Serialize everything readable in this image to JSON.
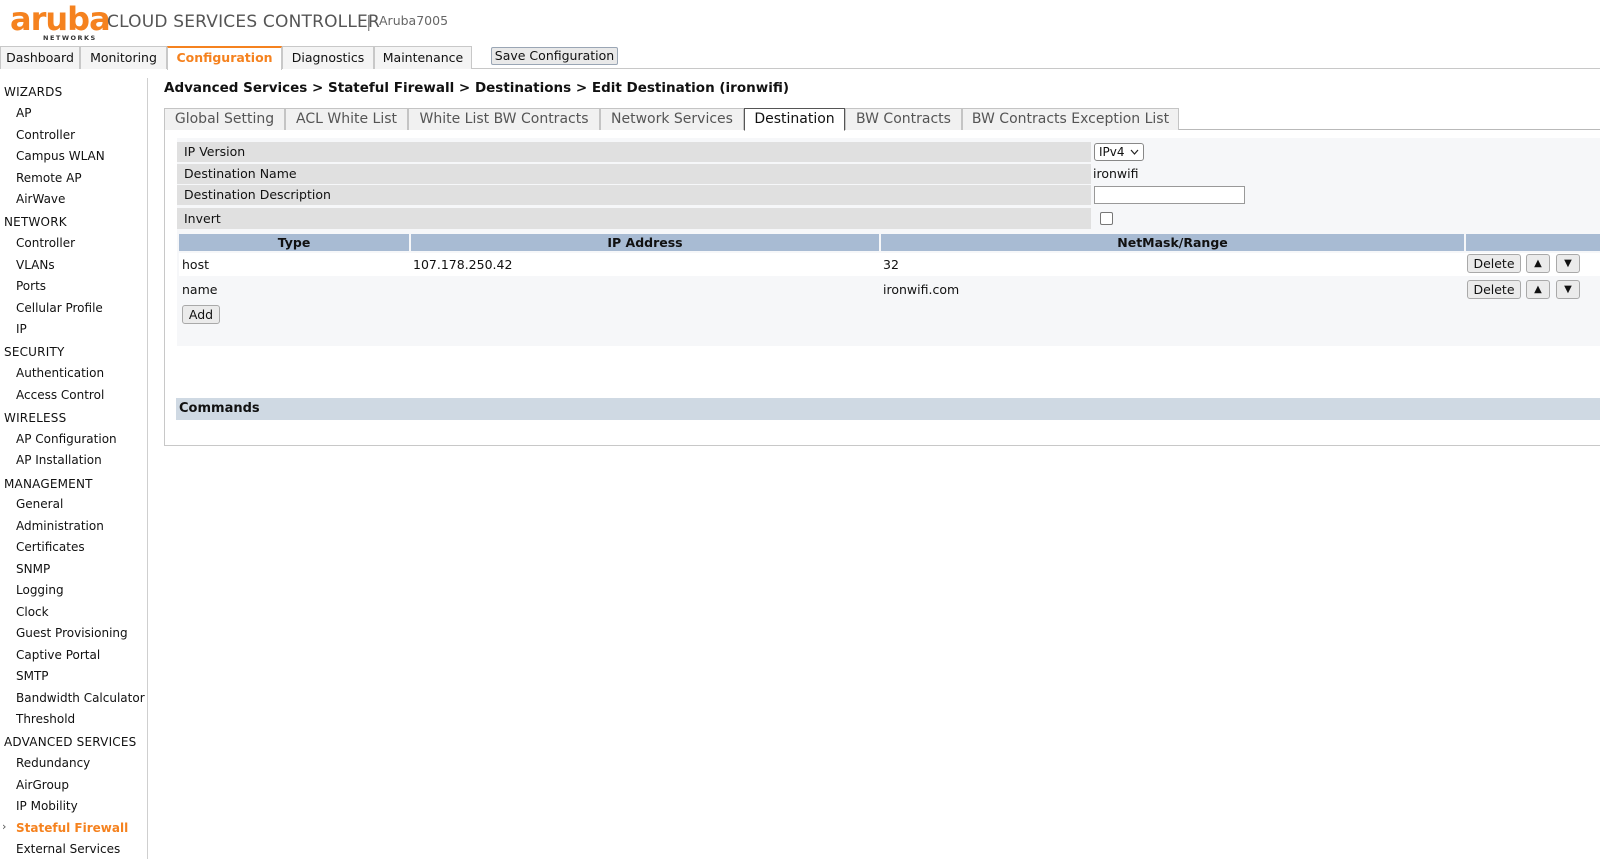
{
  "header": {
    "logo_text": "aruba",
    "logo_subtext": "NETWORKS",
    "app_title": "CLOUD SERVICES CONTROLLER",
    "separator": "|",
    "hostname": "Aruba7005",
    "accent_color": "#f5821f"
  },
  "topnav": {
    "tabs": [
      {
        "label": "Dashboard"
      },
      {
        "label": "Monitoring"
      },
      {
        "label": "Configuration",
        "active": true
      },
      {
        "label": "Diagnostics"
      },
      {
        "label": "Maintenance"
      }
    ],
    "save_label": "Save Configuration"
  },
  "sidebar": {
    "sections": [
      {
        "title": "WIZARDS",
        "items": [
          "AP",
          "Controller",
          "Campus WLAN",
          "Remote AP",
          "AirWave"
        ]
      },
      {
        "title": "NETWORK",
        "items": [
          "Controller",
          "VLANs",
          "Ports",
          "Cellular Profile",
          "IP"
        ]
      },
      {
        "title": "SECURITY",
        "items": [
          "Authentication",
          "Access Control"
        ]
      },
      {
        "title": "WIRELESS",
        "items": [
          "AP Configuration",
          "AP Installation"
        ]
      },
      {
        "title": "MANAGEMENT",
        "items": [
          "General",
          "Administration",
          "Certificates",
          "SNMP",
          "Logging",
          "Clock",
          "Guest Provisioning",
          "Captive Portal",
          "SMTP",
          "Bandwidth Calculator",
          "Threshold"
        ]
      },
      {
        "title": "ADVANCED SERVICES",
        "items": [
          "Redundancy",
          "AirGroup",
          "IP Mobility",
          "Stateful Firewall",
          "External Services"
        ]
      }
    ],
    "active_item": "Stateful Firewall",
    "active_marker": "›"
  },
  "main": {
    "breadcrumb": "Advanced Services > Stateful Firewall > Destinations > Edit Destination (ironwifi)",
    "subtabs": [
      {
        "label": "Global Setting"
      },
      {
        "label": "ACL White List"
      },
      {
        "label": "White List BW Contracts"
      },
      {
        "label": "Network Services"
      },
      {
        "label": "Destination",
        "active": true
      },
      {
        "label": "BW Contracts"
      },
      {
        "label": "BW Contracts Exception List"
      }
    ],
    "form": {
      "ip_version_label": "IP Version",
      "ip_version_value": "IPv4",
      "dest_name_label": "Destination Name",
      "dest_name_value": "ironwifi",
      "dest_desc_label": "Destination Description",
      "dest_desc_value": "",
      "invert_label": "Invert",
      "invert_checked": false
    },
    "table": {
      "headers": [
        "Type",
        "IP Address",
        "NetMask/Range"
      ],
      "rows": [
        {
          "type": "host",
          "ip": "107.178.250.42",
          "mask": "32"
        },
        {
          "type": "name",
          "ip": "",
          "mask": "ironwifi.com"
        }
      ],
      "delete_label": "Delete",
      "up_glyph": "▲",
      "down_glyph": "▼",
      "add_label": "Add"
    },
    "commands_label": "Commands"
  }
}
